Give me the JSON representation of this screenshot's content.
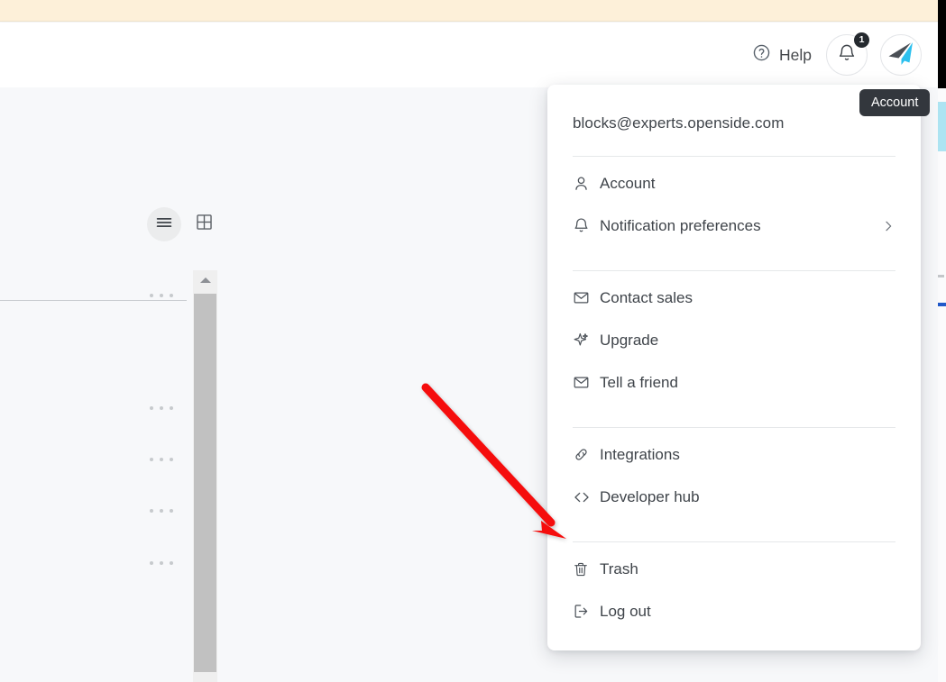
{
  "header": {
    "help_label": "Help",
    "help_icon": "question-circle-icon",
    "notifications_icon": "bell-icon",
    "notifications_count": "1",
    "avatar_icon": "paper-plane-logo"
  },
  "toolbar": {
    "list_view_icon": "list-view-icon",
    "grid_view_icon": "grid-view-icon",
    "row_menu_icon": "ellipsis-icon",
    "row_menu_count": 5
  },
  "scrollbar": {
    "up_arrow_icon": "scroll-up-arrow-icon",
    "thumb_label": "vertical-scroll-thumb"
  },
  "tooltip": {
    "text": "Account"
  },
  "account_menu": {
    "email": "blocks@experts.openside.com",
    "groups": [
      {
        "items": [
          {
            "label": "Account",
            "icon": "user-icon",
            "chevron": false
          },
          {
            "label": "Notification preferences",
            "icon": "bell-icon",
            "chevron": true,
            "chevron_icon": "chevron-right-icon"
          }
        ]
      },
      {
        "items": [
          {
            "label": "Contact sales",
            "icon": "envelope-icon",
            "chevron": false
          },
          {
            "label": "Upgrade",
            "icon": "sparkle-icon",
            "chevron": false
          },
          {
            "label": "Tell a friend",
            "icon": "envelope-icon",
            "chevron": false
          }
        ]
      },
      {
        "items": [
          {
            "label": "Integrations",
            "icon": "link-icon",
            "chevron": false
          },
          {
            "label": "Developer hub",
            "icon": "code-brackets-icon",
            "chevron": false
          }
        ]
      },
      {
        "items": [
          {
            "label": "Trash",
            "icon": "trash-icon",
            "chevron": false
          },
          {
            "label": "Log out",
            "icon": "logout-icon",
            "chevron": false
          }
        ]
      }
    ]
  },
  "annotation": {
    "arrow_color": "#f50808",
    "arrow_from": "472,430",
    "arrow_to": "627,597",
    "points_at": "Trash"
  },
  "colors": {
    "promo_strip": "#fdf0d9",
    "page_background": "#f7f8fa",
    "header_background": "#ffffff",
    "tooltip_background": "#33373d",
    "badge_background": "#24292e",
    "accent_blue": "#2159c9",
    "light_blue": "#ade4f2",
    "scroll_thumb": "#c1c1c1"
  }
}
